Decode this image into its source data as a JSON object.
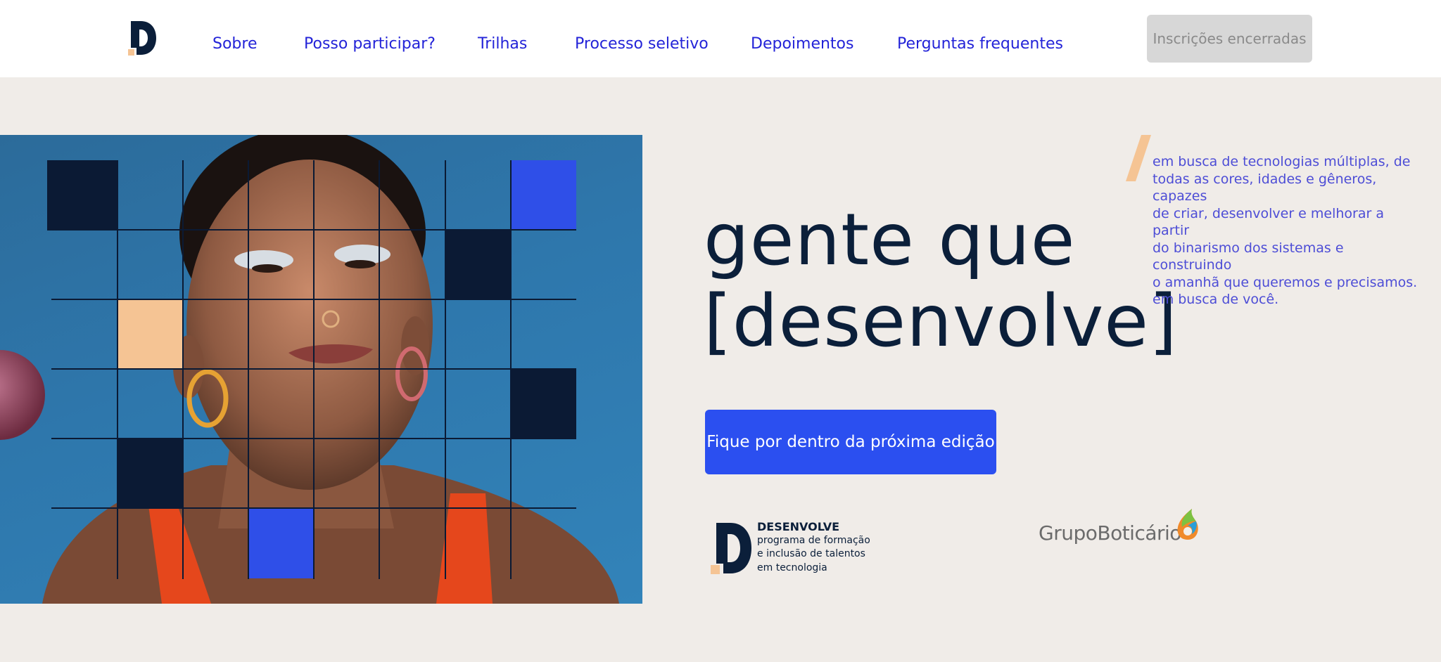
{
  "header": {
    "nav": [
      {
        "label": "Sobre"
      },
      {
        "label": "Posso participar?"
      },
      {
        "label": "Trilhas"
      },
      {
        "label": "Processo seletivo"
      },
      {
        "label": "Depoimentos"
      },
      {
        "label": "Perguntas frequentes"
      }
    ],
    "cta_label": "Inscrições encerradas"
  },
  "hero": {
    "headline_line1": "gente que",
    "headline_line2": "[desenvolve]",
    "tagline_lines": [
      "em busca de tecnologias múltiplas, de",
      "todas as cores, idades e gêneros, capazes",
      "de criar, desenvolver e melhorar a partir",
      "do binarismo dos sistemas e construindo",
      "o amanhã que queremos e precisamos.",
      "em busca de você."
    ],
    "button_label": "Fique por dentro da próxima edição"
  },
  "footer": {
    "desenvolve_title": "DESENVOLVE",
    "desenvolve_lines": [
      "programa de formação",
      "e inclusão de talentos",
      "em tecnologia"
    ],
    "grupo_label": "GrupoBoticário"
  },
  "colors": {
    "nav_link": "#2323d8",
    "navy": "#0b1f3a",
    "blue": "#2b4ff0",
    "peach": "#f5c494",
    "tagline": "#4d4dd6",
    "background": "#f0ece8"
  }
}
